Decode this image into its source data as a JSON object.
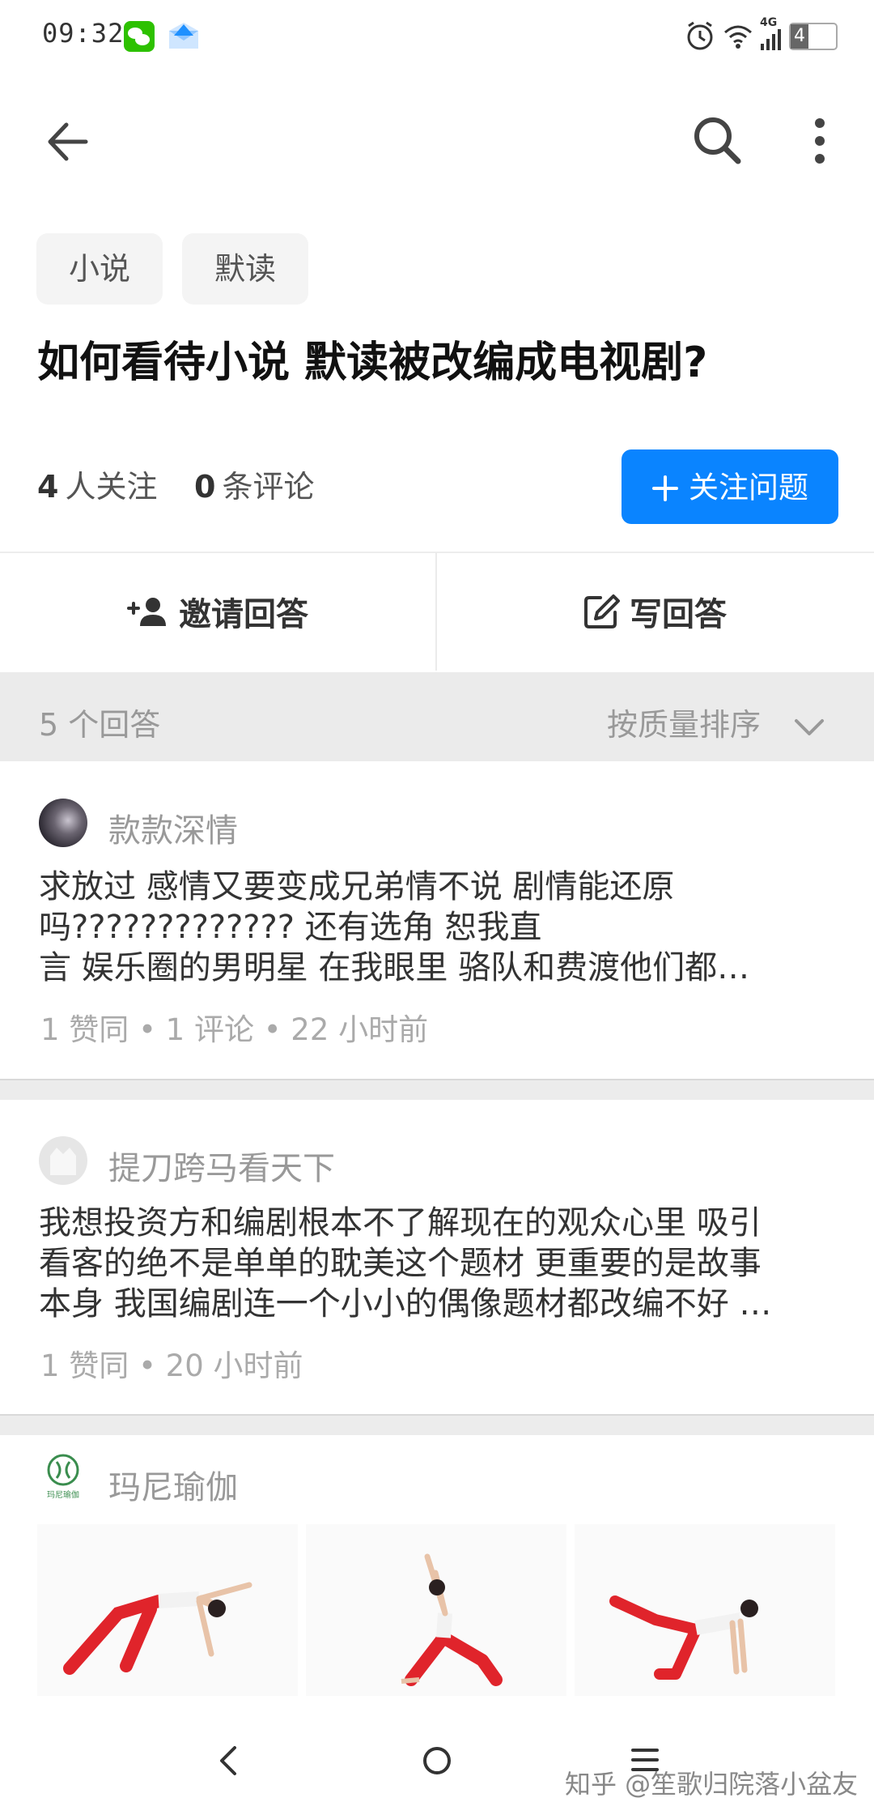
{
  "status_bar": {
    "time": "09:32",
    "network": "4G",
    "battery": "4"
  },
  "nav": {
    "back_icon": "back-arrow-icon",
    "search_icon": "search-icon",
    "more_icon": "more-vertical-icon"
  },
  "tags": [
    "小说",
    "默读"
  ],
  "question": {
    "title": "如何看待小说 默读被改编成电视剧?",
    "followers_count": "4",
    "followers_label": "人关注",
    "comments_count": "0",
    "comments_label": "条评论",
    "follow_button": "关注问题"
  },
  "actions": {
    "invite": "邀请回答",
    "write": "写回答"
  },
  "answers_header": {
    "count_text": "5  个回答",
    "sort_label": "按质量排序"
  },
  "answers": [
    {
      "author": "款款深情",
      "lines": [
        "求放过  感情又要变成兄弟情不说  剧情能还原",
        "吗?????????????  还有选角  恕我直",
        "言  娱乐圈的男明星  在我眼里  骆队和费渡他们都…"
      ],
      "meta": "1  赞同  •  1  评论  •  22  小时前"
    },
    {
      "author": "提刀跨马看天下",
      "lines": [
        "我想投资方和编剧根本不了解现在的观众心里  吸引",
        "看客的绝不是单单的耽美这个题材  更重要的是故事",
        "本身  我国编剧连一个小小的偶像题材都改编不好  …"
      ],
      "meta": "1  赞同  •  20  小时前"
    },
    {
      "author": "玛尼瑜伽",
      "logo_text": "玛尼瑜伽"
    }
  ],
  "watermark": "知乎 @笙歌归院落小盆友",
  "colors": {
    "accent": "#0a84ff",
    "divider": "#ebebeb",
    "muted": "#999999",
    "legging": "#e0242b"
  }
}
